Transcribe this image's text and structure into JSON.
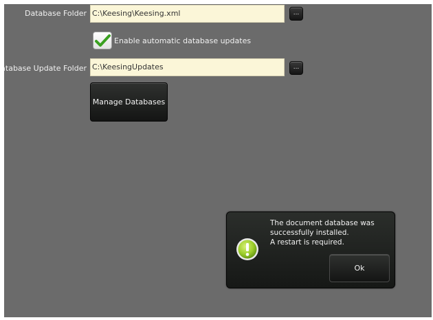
{
  "settings": {
    "database_folder": {
      "label": "Database Folder",
      "value": "C:\\Keesing\\Keesing.xml",
      "browse_label": "..."
    },
    "auto_update": {
      "label": "Enable automatic database updates",
      "checked": true
    },
    "update_folder": {
      "label": "Database Update Folder",
      "value": "C:\\KeesingUpdates",
      "browse_label": "..."
    },
    "manage_button_label": "Manage Databases"
  },
  "dialog": {
    "message_lines": [
      "The document database was",
      "successfully installed.",
      "A restart is required."
    ],
    "icon": "exclamation-icon",
    "ok_label": "Ok"
  },
  "colors": {
    "panel_background": "#6b6b6b",
    "field_background": "#fbf6d8",
    "check_green": "#3aa020",
    "icon_green": "#9ccd2a"
  }
}
